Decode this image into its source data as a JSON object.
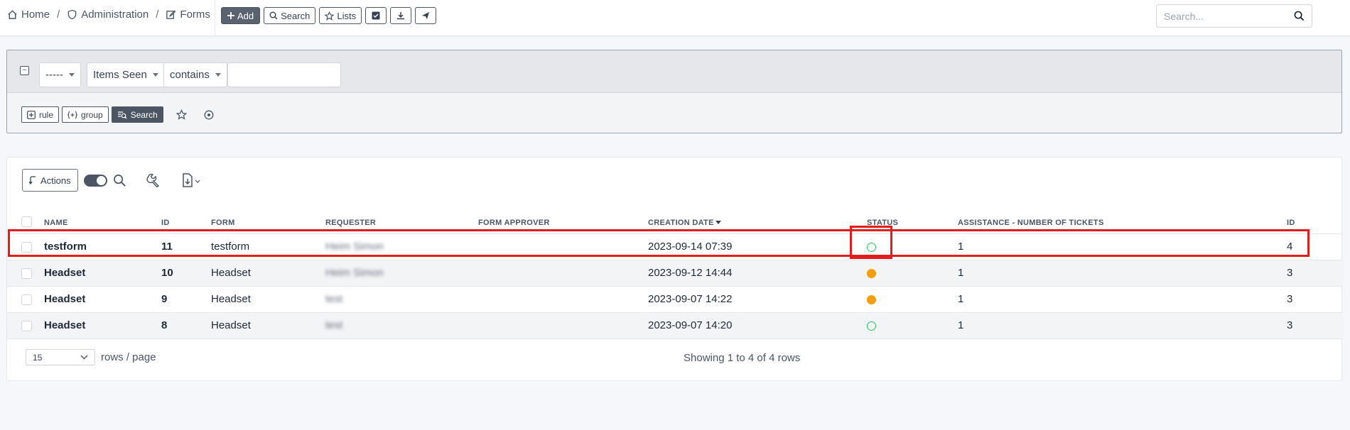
{
  "breadcrumb": {
    "home": "Home",
    "administration": "Administration",
    "forms": "Forms",
    "separator": "/"
  },
  "toolbar": {
    "add_label": "Add",
    "search_label": "Search",
    "lists_label": "Lists"
  },
  "global_search": {
    "placeholder": "Search..."
  },
  "filter": {
    "field_select": "-----",
    "criteria_select": "Items Seen",
    "operator_select": "contains",
    "value": "",
    "rule_label": "rule",
    "group_label": "group",
    "search_label": "Search"
  },
  "results": {
    "actions_label": "Actions",
    "columns": [
      "NAME",
      "ID",
      "FORM",
      "REQUESTER",
      "FORM APPROVER",
      "CREATION DATE",
      "STATUS",
      "ASSISTANCE - NUMBER OF TICKETS",
      "ID"
    ],
    "rows": [
      {
        "name": "testform",
        "id": "11",
        "form": "testform",
        "requester": "Heim Simon",
        "approver": "",
        "date": "2023-09-14 07:39",
        "status": "open",
        "tickets": "1",
        "id2": "4"
      },
      {
        "name": "Headset",
        "id": "10",
        "form": "Headset",
        "requester": "Heim Simon",
        "approver": "",
        "date": "2023-09-12 14:44",
        "status": "pending",
        "tickets": "1",
        "id2": "3"
      },
      {
        "name": "Headset",
        "id": "9",
        "form": "Headset",
        "requester": "test",
        "approver": "",
        "date": "2023-09-07 14:22",
        "status": "pending",
        "tickets": "1",
        "id2": "3"
      },
      {
        "name": "Headset",
        "id": "8",
        "form": "Headset",
        "requester": "test",
        "approver": "",
        "date": "2023-09-07 14:20",
        "status": "open",
        "tickets": "1",
        "id2": "3"
      }
    ],
    "page_size": "15",
    "rows_per_page_label": "rows / page",
    "showing_text": "Showing 1 to 4 of 4 rows"
  },
  "colors": {
    "status_open": "#22c55e",
    "status_pending": "#f59e0b",
    "highlight": "#e11d1d"
  }
}
